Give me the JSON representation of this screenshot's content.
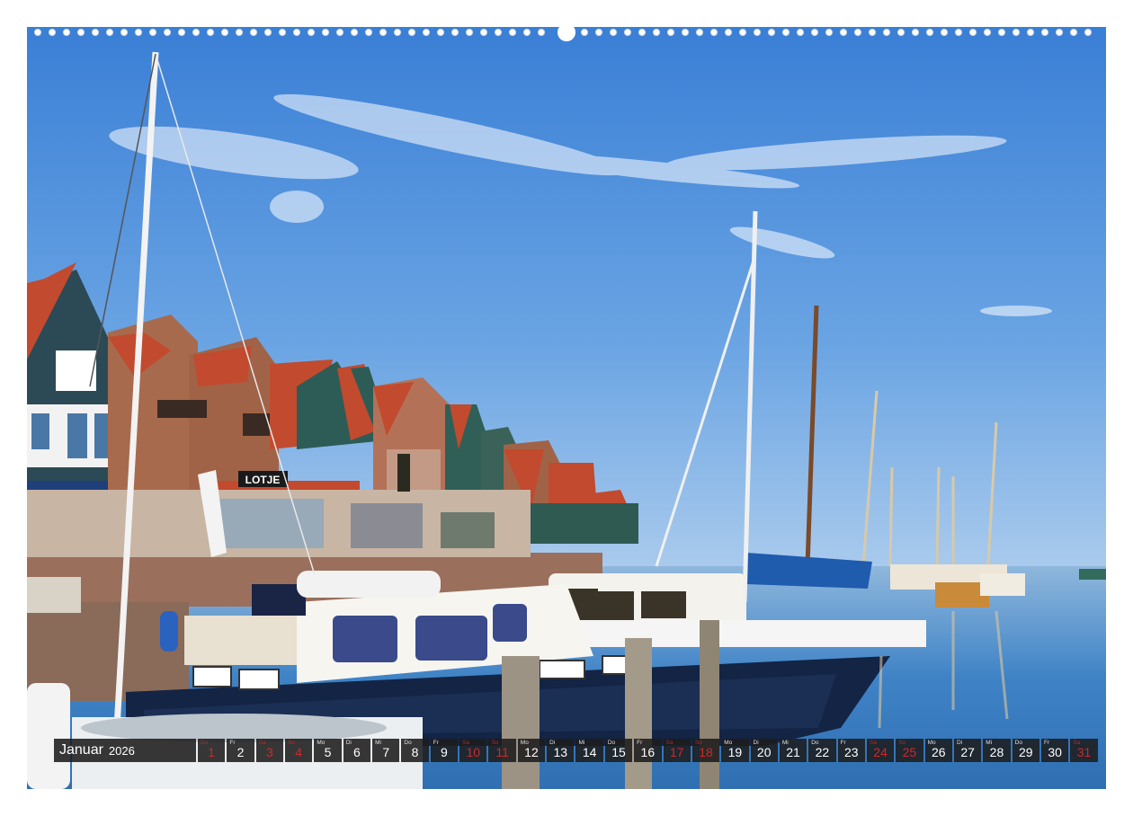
{
  "calendar": {
    "month": "Januar",
    "year": "2026",
    "days": [
      {
        "wd": "Do",
        "num": "1",
        "weekend": true
      },
      {
        "wd": "Fr",
        "num": "2",
        "weekend": false
      },
      {
        "wd": "Sa",
        "num": "3",
        "weekend": true
      },
      {
        "wd": "So",
        "num": "4",
        "weekend": true
      },
      {
        "wd": "Mo",
        "num": "5",
        "weekend": false
      },
      {
        "wd": "Di",
        "num": "6",
        "weekend": false
      },
      {
        "wd": "Mi",
        "num": "7",
        "weekend": false
      },
      {
        "wd": "Do",
        "num": "8",
        "weekend": false
      },
      {
        "wd": "Fr",
        "num": "9",
        "weekend": false
      },
      {
        "wd": "Sa",
        "num": "10",
        "weekend": true
      },
      {
        "wd": "So",
        "num": "11",
        "weekend": true
      },
      {
        "wd": "Mo",
        "num": "12",
        "weekend": false
      },
      {
        "wd": "Di",
        "num": "13",
        "weekend": false
      },
      {
        "wd": "Mi",
        "num": "14",
        "weekend": false
      },
      {
        "wd": "Do",
        "num": "15",
        "weekend": false
      },
      {
        "wd": "Fr",
        "num": "16",
        "weekend": false
      },
      {
        "wd": "Sa",
        "num": "17",
        "weekend": true
      },
      {
        "wd": "So",
        "num": "18",
        "weekend": true
      },
      {
        "wd": "Mo",
        "num": "19",
        "weekend": false
      },
      {
        "wd": "Di",
        "num": "20",
        "weekend": false
      },
      {
        "wd": "Mi",
        "num": "21",
        "weekend": false
      },
      {
        "wd": "Do",
        "num": "22",
        "weekend": false
      },
      {
        "wd": "Fr",
        "num": "23",
        "weekend": false
      },
      {
        "wd": "Sa",
        "num": "24",
        "weekend": true
      },
      {
        "wd": "So",
        "num": "25",
        "weekend": true
      },
      {
        "wd": "Mo",
        "num": "26",
        "weekend": false
      },
      {
        "wd": "Di",
        "num": "27",
        "weekend": false
      },
      {
        "wd": "Mi",
        "num": "28",
        "weekend": false
      },
      {
        "wd": "Do",
        "num": "29",
        "weekend": false
      },
      {
        "wd": "Fr",
        "num": "30",
        "weekend": false
      },
      {
        "wd": "Sa",
        "num": "31",
        "weekend": true
      }
    ]
  },
  "photo": {
    "storefront_sign": "LOTJE"
  },
  "colors": {
    "sky_top": "#3f82d6",
    "sky_bottom": "#a9c9ec",
    "water": "#3d7fc0",
    "roof_red": "#c0442c",
    "house_green": "#2f5a52",
    "brick": "#a8735a",
    "hull_navy": "#15264a",
    "tarp_blue": "#1c5aa8",
    "weekend_red": "#d02828",
    "calendar_bg": "#1c1c1c"
  }
}
